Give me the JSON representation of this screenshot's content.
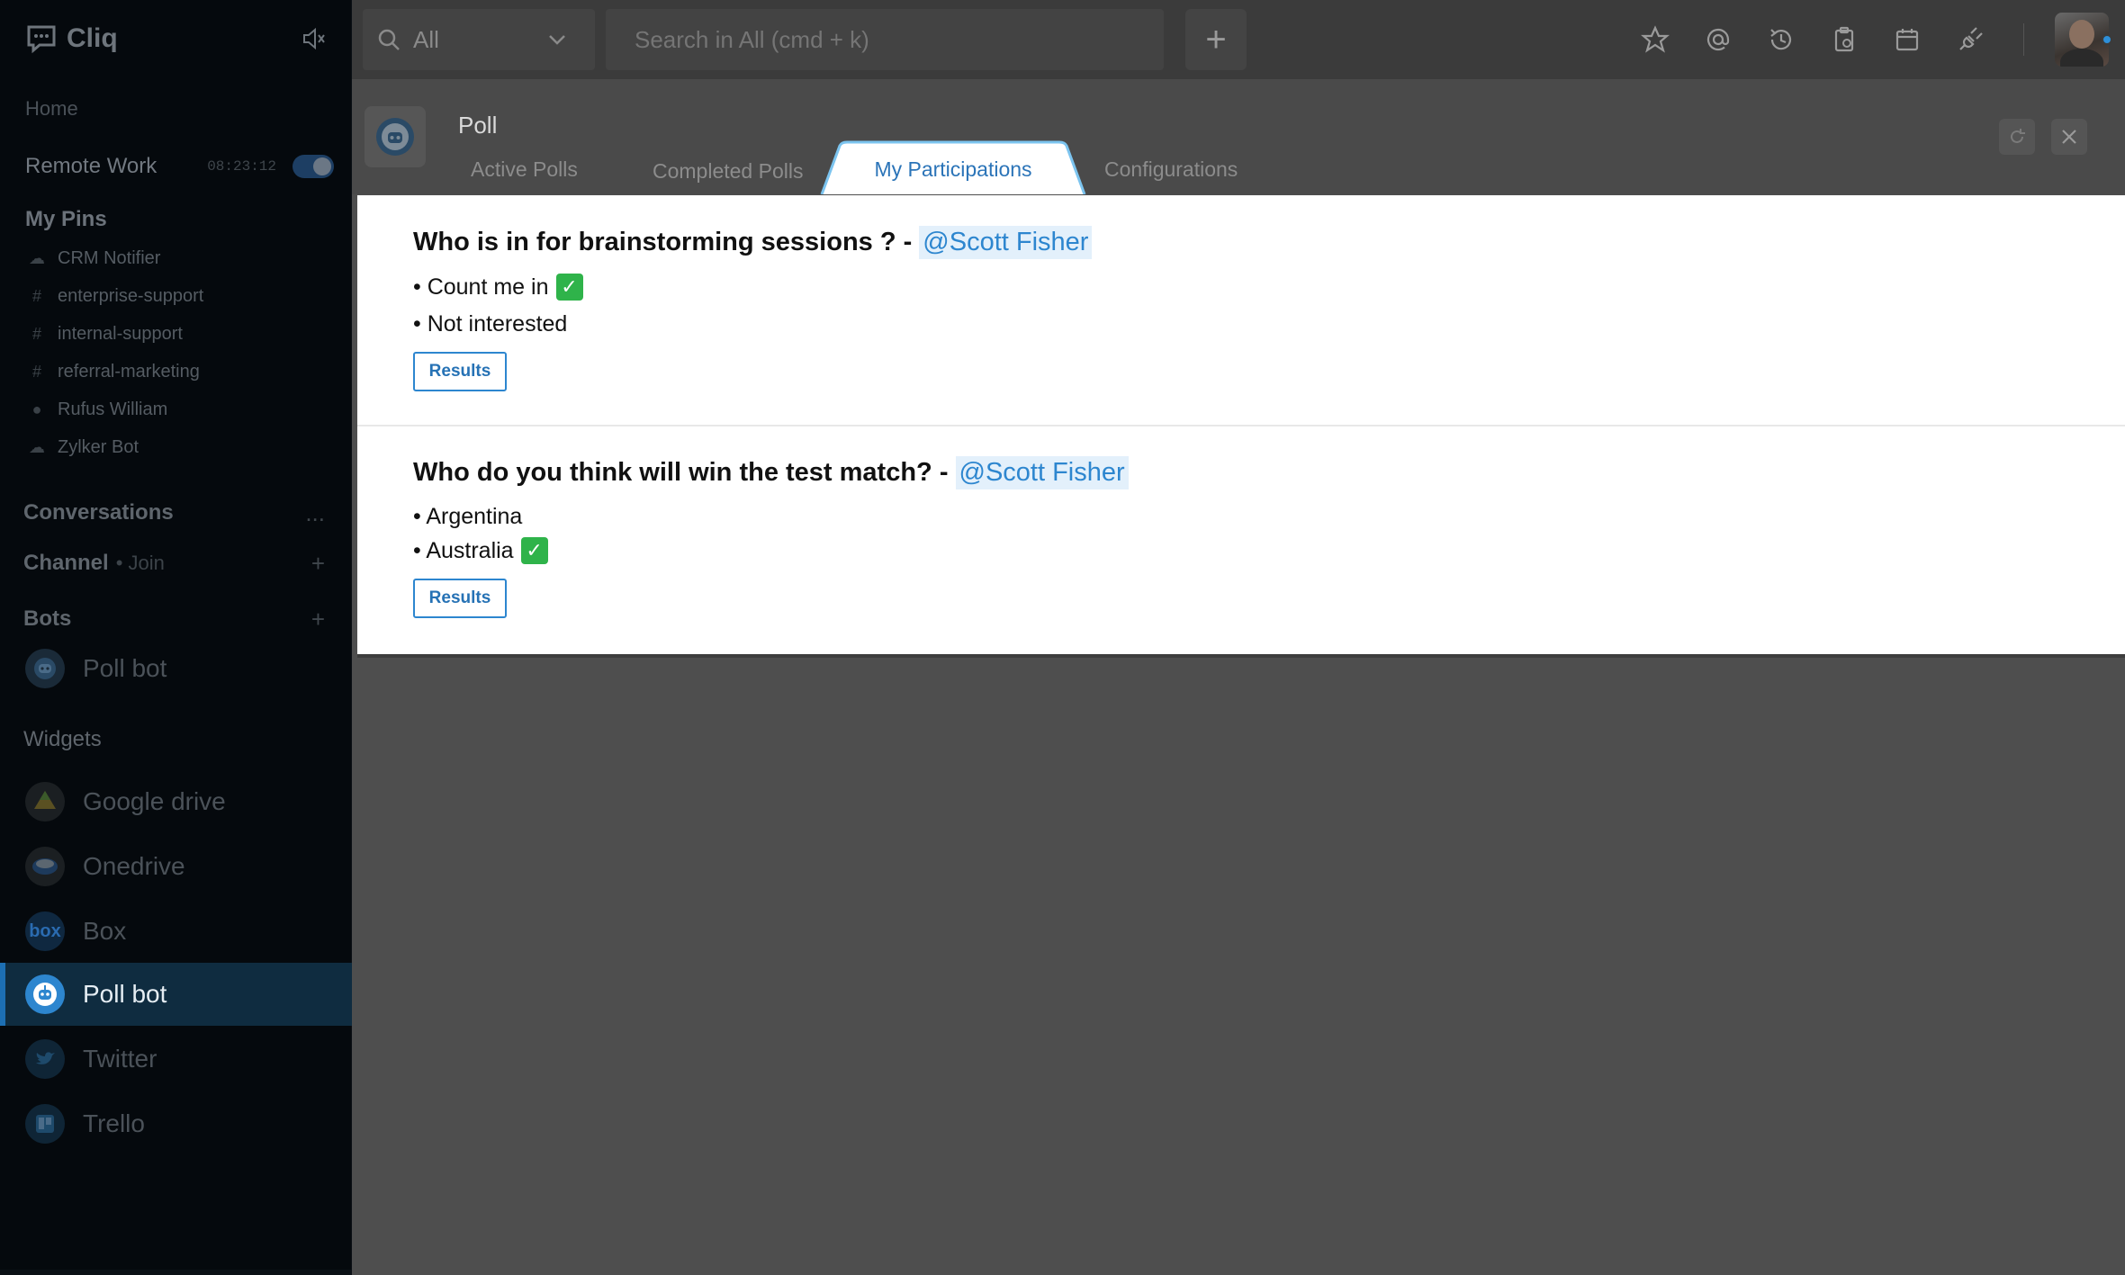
{
  "app": {
    "name": "Cliq"
  },
  "sidebar": {
    "home": "Home",
    "remote_work": {
      "label": "Remote Work",
      "timer": "08:23:12"
    },
    "pins_title": "My Pins",
    "pins": [
      {
        "label": "CRM Notifier",
        "icon": "bot-icon"
      },
      {
        "label": "enterprise-support",
        "icon": "hash-icon"
      },
      {
        "label": "internal-support",
        "icon": "hash-icon"
      },
      {
        "label": "referral-marketing",
        "icon": "hash-icon"
      },
      {
        "label": "Rufus William",
        "icon": "user-status-icon"
      },
      {
        "label": "Zylker Bot",
        "icon": "bot-icon"
      }
    ],
    "conversations": "Conversations",
    "conversations_more": "...",
    "channel": "Channel",
    "channel_join": "• Join",
    "bots": "Bots",
    "bot_items": [
      {
        "label": "Poll bot"
      }
    ],
    "widgets": "Widgets",
    "widget_items": [
      {
        "label": "Google drive",
        "color": "#c9a13a"
      },
      {
        "label": "Onedrive",
        "color": "#2a6fc0"
      },
      {
        "label": "Box",
        "color": "#1a6bd1",
        "badge": "box"
      },
      {
        "label": "Poll bot",
        "color": "#2d86cf",
        "active": true
      },
      {
        "label": "Twitter",
        "color": "#1d9bf0"
      },
      {
        "label": "Trello",
        "color": "#1f6fb5"
      }
    ]
  },
  "topbar": {
    "scope": "All",
    "search_placeholder": "Search in All (cmd + k)",
    "add": "+",
    "icons": [
      "star-icon",
      "mention-icon",
      "history-icon",
      "clipboard-icon",
      "calendar-icon",
      "plug-icon"
    ]
  },
  "widget": {
    "title": "Poll",
    "tabs": [
      "Active Polls",
      "Completed Polls",
      "My Participations",
      "Configurations"
    ],
    "active_tab": "My Participations"
  },
  "polls": [
    {
      "question": "Who is in for brainstorming sessions ? -",
      "mention": "@Scott Fisher",
      "options": [
        {
          "label": "• Count me in",
          "selected": true
        },
        {
          "label": "• Not interested",
          "selected": false
        }
      ],
      "button": "Results"
    },
    {
      "question": "Who do you think  will win the test match? -",
      "mention": "@Scott Fisher",
      "options": [
        {
          "label": "• Argentina",
          "selected": false
        },
        {
          "label": "• Australia",
          "selected": true
        }
      ],
      "button": "Results"
    }
  ],
  "colors": {
    "accent": "#2d86cf",
    "sidebar_bg": "#05090d",
    "check": "#2fb34a"
  }
}
